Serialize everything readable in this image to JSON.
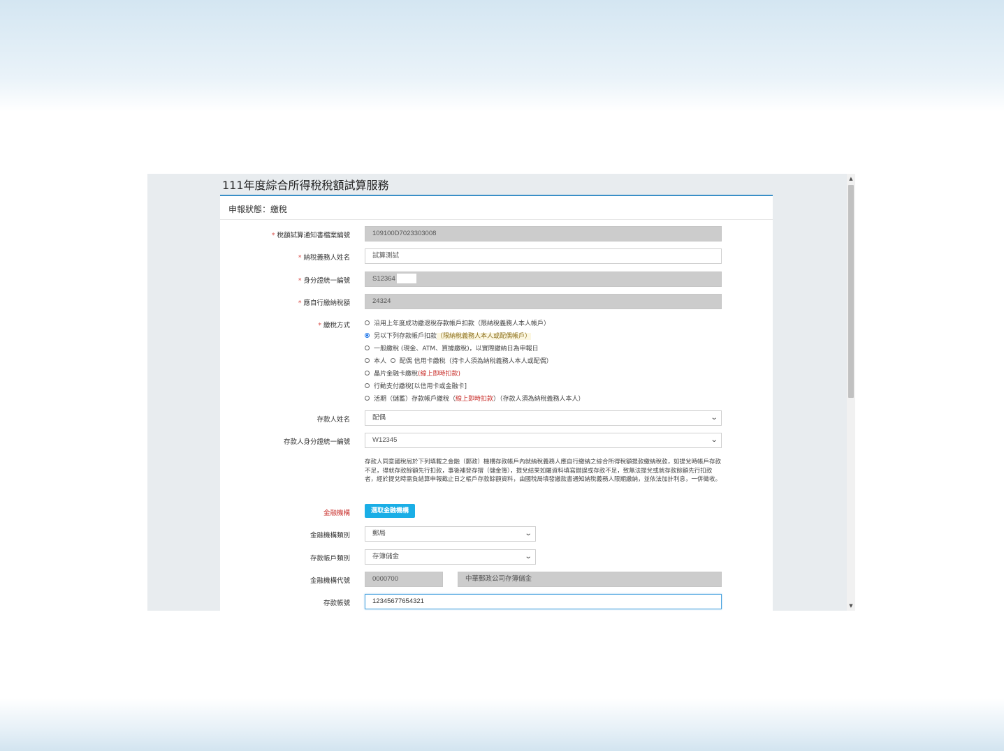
{
  "page": {
    "title": "111年度綜合所得稅稅額試算服務",
    "status": "申報狀態：繳稅"
  },
  "form": {
    "notice_no_label": "稅額試算通知書檔案編號",
    "notice_no_value": "109100D7023303008",
    "taxpayer_name_label": "納稅義務人姓名",
    "taxpayer_name_value": "試算測試",
    "id_label": "身分證統一編號",
    "id_value": "S12364",
    "amount_label": "應自行繳納稅額",
    "amount_value": "24324",
    "pay_method_label": "繳稅方式",
    "pay_options": [
      {
        "text": "沿用上年度成功繳退稅存款帳戶扣款（限納稅義務人本人帳戶）",
        "selected": false
      },
      {
        "text_a": "另以下列存款帳戶扣款",
        "text_b": "（限納稅義務人本人或配偶帳戶）",
        "selected": true
      },
      {
        "text": "一般繳稅 (現金、ATM、買據繳稅)，以實際繳納日為申報日",
        "selected": false
      },
      {
        "text_a": "本人",
        "text_b": "配偶 信用卡繳稅（持卡人須為納稅義務人本人或配偶）",
        "selected": false
      },
      {
        "text_a": "晶片金融卡繳稅",
        "text_b": "(線上即時扣款)",
        "selected": false
      },
      {
        "text": "行動支付繳稅[以信用卡或金融卡]",
        "selected": false
      },
      {
        "text_a": "活期（儲蓄）存款帳戶繳稅（",
        "text_b": "線上即時扣款",
        "text_c": "）（存款人須為納稅義務人本人）",
        "selected": false
      }
    ],
    "depositor_name_label": "存款人姓名",
    "depositor_name_value": "配偶",
    "depositor_id_label": "存款人身分證統一編號",
    "depositor_id_value": "W12345",
    "notice_text": "存款人同意國稅局於下列填載之金融（郵政）機構存款帳戶內就納稅義務人應自行繳納之綜合所得稅額提款繳納稅款，如提兌時帳戶存款不足，得就存款餘額先行扣款，事後補登存摺（儲金簿），提兌結果如屬資料填寫錯誤或存款不足，致無法提兌或就存款餘額先行扣款者，經於提兌時需負結算申報截止日之帳戶存款餘額資料，由國稅局填發繳款書通知納稅義務人限期繳納，並依法加計利息，一併徵收。",
    "bank_label": "金融機構",
    "bank_button": "選取金融機構",
    "bank_type_label": "金融機構類別",
    "bank_type_value": "郵局",
    "account_type_label": "存款帳戶類別",
    "account_type_value": "存簿儲金",
    "bank_code_label": "金融機構代號",
    "bank_code_value": "0000700",
    "bank_name_value": "中華郵政公司存簿儲金",
    "account_no_label": "存款帳號",
    "account_no_value": "12345677654321"
  }
}
